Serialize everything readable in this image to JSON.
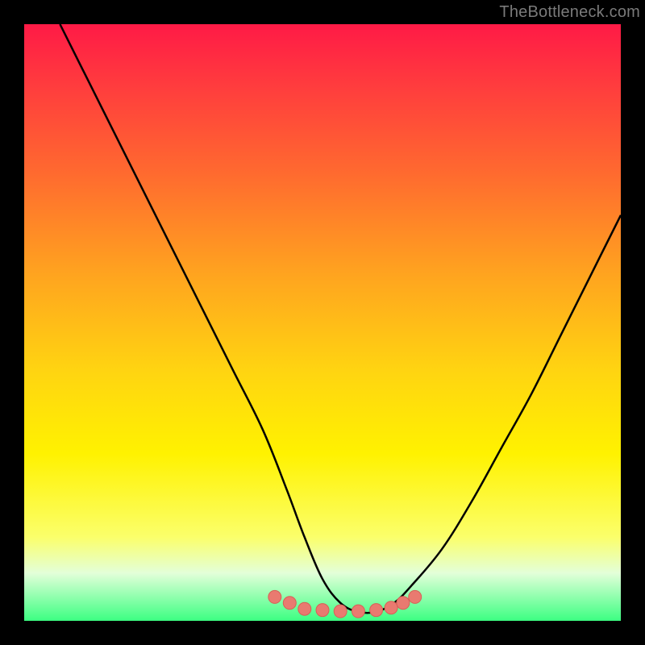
{
  "watermark": "TheBottleneck.com",
  "colors": {
    "curve": "#000000",
    "marker_fill": "#e97a70",
    "marker_stroke": "#d85f55"
  },
  "chart_data": {
    "type": "line",
    "title": "",
    "xlabel": "",
    "ylabel": "",
    "xlim": [
      0,
      100
    ],
    "ylim": [
      0,
      100
    ],
    "grid": false,
    "legend": false,
    "series": [
      {
        "name": "curve",
        "x": [
          6,
          10,
          15,
          20,
          25,
          30,
          35,
          40,
          44,
          47,
          50,
          53,
          56,
          59,
          62,
          65,
          70,
          75,
          80,
          85,
          90,
          95,
          100
        ],
        "y": [
          100,
          92,
          82,
          72,
          62,
          52,
          42,
          32,
          22,
          14,
          7,
          3,
          1.5,
          1.5,
          3,
          6,
          12,
          20,
          29,
          38,
          48,
          58,
          68
        ],
        "style": "line"
      },
      {
        "name": "bottom-markers",
        "x": [
          42,
          44.5,
          47,
          50,
          53,
          56,
          59,
          61.5,
          63.5,
          65.5
        ],
        "y": [
          4,
          3,
          2,
          1.8,
          1.6,
          1.6,
          1.8,
          2.2,
          3.0,
          4.0
        ],
        "style": "scatter"
      }
    ]
  }
}
